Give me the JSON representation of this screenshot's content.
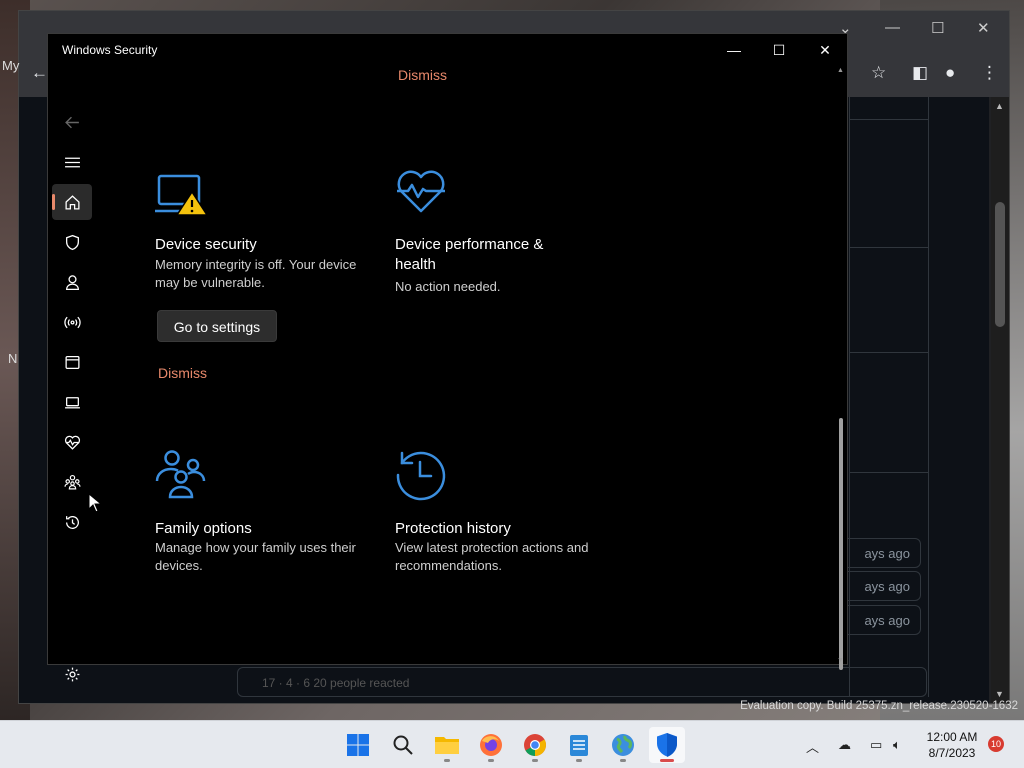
{
  "window": {
    "title": "Windows Security",
    "controls": {
      "minimize": "—",
      "maximize": "☐",
      "close": "✕"
    }
  },
  "nav": {
    "items": [
      {
        "name": "back",
        "icon": "back-arrow-icon"
      },
      {
        "name": "menu",
        "icon": "hamburger-menu-icon"
      },
      {
        "name": "home",
        "icon": "home-icon",
        "active": true
      },
      {
        "name": "virus-threat-protection",
        "icon": "shield-icon"
      },
      {
        "name": "account-protection",
        "icon": "person-icon"
      },
      {
        "name": "firewall-network",
        "icon": "wireless-signal-icon"
      },
      {
        "name": "app-browser-control",
        "icon": "app-window-icon"
      },
      {
        "name": "device-security",
        "icon": "laptop-icon"
      },
      {
        "name": "device-performance",
        "icon": "heart-pulse-icon"
      },
      {
        "name": "family-options",
        "icon": "family-icon"
      },
      {
        "name": "protection-history",
        "icon": "history-clock-icon"
      },
      {
        "name": "settings",
        "icon": "gear-icon"
      }
    ]
  },
  "main": {
    "top_dismiss": "Dismiss",
    "cards": [
      {
        "id": "device-security",
        "icon": "laptop-warning-icon",
        "title": "Device security",
        "description": "Memory integrity is off. Your device may be vulnerable.",
        "button": "Go to settings",
        "dismiss": "Dismiss"
      },
      {
        "id": "device-performance",
        "icon": "heart-pulse-icon",
        "title": "Device performance & health",
        "description": "No action needed."
      },
      {
        "id": "family-options",
        "icon": "family-icon",
        "title": "Family options",
        "description": "Manage how your family uses their devices."
      },
      {
        "id": "protection-history",
        "icon": "history-clock-icon",
        "title": "Protection history",
        "description": "View latest protection actions and recommendations."
      }
    ]
  },
  "colors": {
    "accent": "#e8896b",
    "icon_blue": "#3b8ede",
    "warning_yellow": "#f4c20d",
    "window_bg": "#000000"
  },
  "background_browser": {
    "left_text": [
      "My",
      "N"
    ],
    "days_ago": [
      "ays ago",
      "ays ago",
      "ays ago"
    ],
    "reactions": "17 · 4 · 6   20 people reacted"
  },
  "watermark": "Evaluation copy. Build 25375.zn_release.230520-1632",
  "taskbar": {
    "apps": [
      "start",
      "search",
      "file-explorer",
      "firefox",
      "chrome",
      "notepad",
      "earth",
      "windows-security"
    ],
    "clock_time": "12:00 AM",
    "clock_date": "8/7/2023",
    "notification_count": "10"
  }
}
